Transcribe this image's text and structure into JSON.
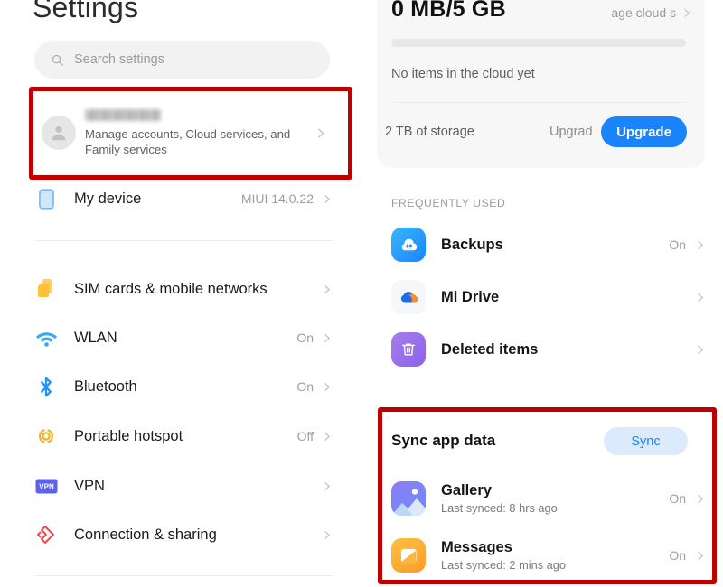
{
  "left": {
    "title": "Settings",
    "search": {
      "placeholder": "Search settings",
      "icon": "search-icon"
    },
    "account": {
      "name_redacted": "",
      "subtitle": "Manage accounts, Cloud services, and Family services",
      "avatar_icon": "person-avatar-icon",
      "chevron": "chevron-right-icon"
    },
    "items": [
      {
        "label": "My device",
        "value": "MIUI 14.0.22",
        "icon": "device-icon"
      },
      {
        "label": "SIM cards & mobile networks",
        "value": "",
        "icon": "sim-card-icon"
      },
      {
        "label": "WLAN",
        "value": "On",
        "icon": "wifi-icon"
      },
      {
        "label": "Bluetooth",
        "value": "On",
        "icon": "bluetooth-icon"
      },
      {
        "label": "Portable hotspot",
        "value": "Off",
        "icon": "hotspot-icon"
      },
      {
        "label": "VPN",
        "value": "",
        "icon": "vpn-icon"
      },
      {
        "label": "Connection & sharing",
        "value": "",
        "icon": "connection-sharing-icon"
      }
    ]
  },
  "right": {
    "cloud": {
      "usage": "0 MB/5 GB",
      "manage_link": "age cloud s",
      "empty_text": "No items in the cloud yet",
      "storage_text": "2 TB of storage",
      "upgrade_text": "Upgrad",
      "upgrade_button": "Upgrade",
      "progress_percent": 0
    },
    "frequently_used": {
      "header": "FREQUENTLY USED",
      "items": [
        {
          "label": "Backups",
          "value": "On",
          "icon": "backups-cloud-icon"
        },
        {
          "label": "Mi Drive",
          "value": "",
          "icon": "mi-drive-icon"
        },
        {
          "label": "Deleted items",
          "value": "",
          "icon": "trash-icon"
        }
      ]
    },
    "sync": {
      "header": "Sync app data",
      "sync_button": "Sync",
      "items": [
        {
          "label": "Gallery",
          "sub": "Last synced: 8 hrs ago",
          "value": "On",
          "icon": "gallery-icon"
        },
        {
          "label": "Messages",
          "sub": "Last synced: 2 mins ago",
          "value": "On",
          "icon": "messages-icon"
        }
      ]
    }
  },
  "annotations": {
    "highlight_color": "#c00000",
    "boxes": [
      "account-row-highlight",
      "sync-app-data-highlight"
    ]
  }
}
